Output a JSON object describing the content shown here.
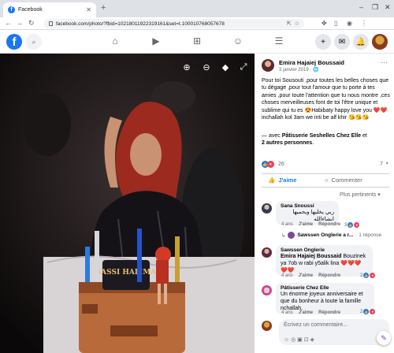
{
  "browser": {
    "tab_title": "Facebook",
    "url": "facebook.com/photo/?fbid=10218011922319161&set=t.100010768057678",
    "window_controls": [
      "–",
      "❐",
      "✕"
    ]
  },
  "post": {
    "author": "Emira Hajaiej Boussaid",
    "date": "3 janvier 2019 · 🌐",
    "text": "Pour toi Sousouti ,pour toutes les belles choses que tu dégage ,pour tout l'amour que tu porte à tes amies ,pour toute l'attention que tu nous montre ,ces choses merveilleuses font de toi l'être unique et sublime qui tu es 😍Habibaty happy love you ❤️❤️inchallah kol 3am we inti be alf khir 😘😘😘",
    "with_prefix": "— avec",
    "with_page": "Pâtisserie Seshelles Chez Elle",
    "with_and": "et",
    "with_others": "2 autres personnes",
    "reaction_count": "26",
    "comment_count": "7"
  },
  "actions": {
    "like_label": "J'aime",
    "comment_label": "Commenter",
    "sort_label": "Plus pertinents ▾"
  },
  "comments": [
    {
      "name": "Sana Snoussi",
      "text": "ربي يخليها ويحميها انشاءالله",
      "time": "4 ans",
      "like": "J'aime",
      "reply": "Répondre",
      "reactions": "3"
    },
    {
      "name": "Sawssen Onglerie",
      "mention": "Emira Hajaiej Boussaid",
      "text": "Bouzinek ya 7ob w rabi y5alik lina ❤️❤️❤️❤️❤️",
      "time": "4 ans",
      "like": "J'aime",
      "reply": "Répondre",
      "reactions": "2"
    },
    {
      "name": "Pâtisserie Chez Elle",
      "text": "Un énorme joyeux anniversaire et que du bonheur à toute la famille nchallah.",
      "time": "4 ans",
      "like": "J'aime",
      "reply": "Répondre",
      "reactions": "2"
    }
  ],
  "reply_preview": {
    "name": "Sawssen Onglerie a r...",
    "count": "· 1 réponse"
  },
  "composer": {
    "placeholder": "Écrivez un commentaire...",
    "icons": "☺ ◎ ▣ ⊡ ◈"
  },
  "photo": {
    "cake_text": "SASSI HALIMA"
  },
  "colors": {
    "accent": "#1877f2",
    "like_blue": "#1877f2",
    "love_red": "#f33e58",
    "haha_yellow": "#f7b125"
  }
}
